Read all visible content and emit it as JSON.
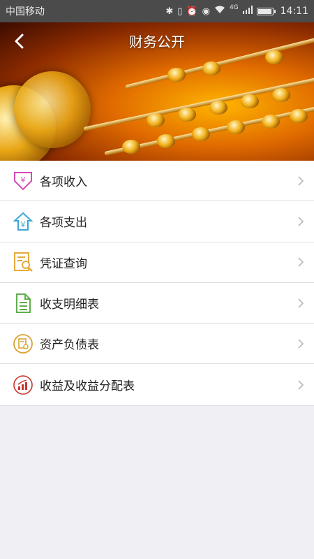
{
  "status_bar": {
    "carrier": "中国移动",
    "network": "4G",
    "time": "14:11",
    "icons": [
      "bluetooth-icon",
      "vibrate-icon",
      "alarm-icon",
      "eye-icon",
      "wifi-icon",
      "signal-icon",
      "battery-icon"
    ]
  },
  "header": {
    "title": "财务公开",
    "back_icon": "back-arrow-icon"
  },
  "menu": {
    "items": [
      {
        "label": "各项收入",
        "icon": "income-icon",
        "color": "#d54ab5"
      },
      {
        "label": "各项支出",
        "icon": "expense-icon",
        "color": "#3aa6d8"
      },
      {
        "label": "凭证查询",
        "icon": "voucher-search-icon",
        "color": "#e7a93b"
      },
      {
        "label": "收支明细表",
        "icon": "detail-sheet-icon",
        "color": "#5fae4c"
      },
      {
        "label": "资产负债表",
        "icon": "balance-sheet-icon",
        "color": "#d9a436"
      },
      {
        "label": "收益及收益分配表",
        "icon": "profit-chart-icon",
        "color": "#c9342f"
      }
    ]
  }
}
